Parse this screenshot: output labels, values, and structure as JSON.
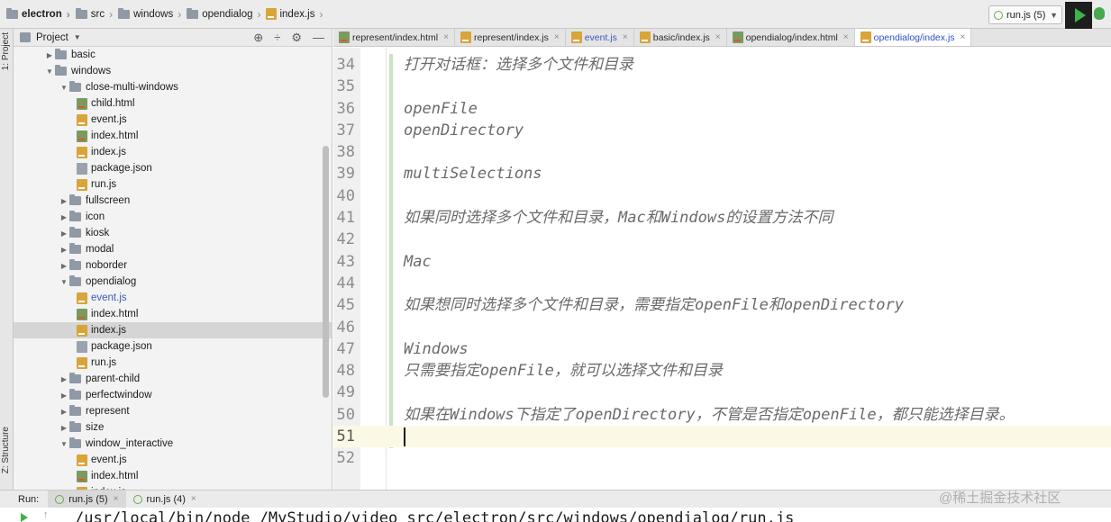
{
  "breadcrumb": {
    "items": [
      {
        "label": "electron",
        "icon": "folder-icon"
      },
      {
        "label": "src",
        "icon": "folder-icon"
      },
      {
        "label": "windows",
        "icon": "folder-icon"
      },
      {
        "label": "opendialog",
        "icon": "folder-icon"
      },
      {
        "label": "index.js",
        "icon": "js-file-icon"
      }
    ]
  },
  "toolbar": {
    "run_config": "run.js (5)",
    "run_icon": "play-icon",
    "debug_icon": "bug-icon"
  },
  "left_strip": {
    "project_tab": "1: Project",
    "structure_tab": "Z: Structure"
  },
  "project_panel": {
    "title": "Project",
    "tools": [
      "target-icon",
      "collapse-icon",
      "gear-icon",
      "minimize-icon"
    ]
  },
  "tree": [
    {
      "label": "basic",
      "type": "folder",
      "depth": 2,
      "expanded": false
    },
    {
      "label": "windows",
      "type": "folder",
      "depth": 2,
      "expanded": true
    },
    {
      "label": "close-multi-windows",
      "type": "folder",
      "depth": 3,
      "expanded": true
    },
    {
      "label": "child.html",
      "type": "html",
      "depth": 4
    },
    {
      "label": "event.js",
      "type": "js",
      "depth": 4
    },
    {
      "label": "index.html",
      "type": "html",
      "depth": 4
    },
    {
      "label": "index.js",
      "type": "js",
      "depth": 4
    },
    {
      "label": "package.json",
      "type": "json",
      "depth": 4
    },
    {
      "label": "run.js",
      "type": "js",
      "depth": 4
    },
    {
      "label": "fullscreen",
      "type": "folder",
      "depth": 3,
      "expanded": false
    },
    {
      "label": "icon",
      "type": "folder",
      "depth": 3,
      "expanded": false
    },
    {
      "label": "kiosk",
      "type": "folder",
      "depth": 3,
      "expanded": false
    },
    {
      "label": "modal",
      "type": "folder",
      "depth": 3,
      "expanded": false
    },
    {
      "label": "noborder",
      "type": "folder",
      "depth": 3,
      "expanded": false
    },
    {
      "label": "opendialog",
      "type": "folder",
      "depth": 3,
      "expanded": true
    },
    {
      "label": "event.js",
      "type": "js",
      "depth": 4,
      "modified": true
    },
    {
      "label": "index.html",
      "type": "html",
      "depth": 4
    },
    {
      "label": "index.js",
      "type": "js",
      "depth": 4,
      "selected": true
    },
    {
      "label": "package.json",
      "type": "json",
      "depth": 4
    },
    {
      "label": "run.js",
      "type": "js",
      "depth": 4
    },
    {
      "label": "parent-child",
      "type": "folder",
      "depth": 3,
      "expanded": false
    },
    {
      "label": "perfectwindow",
      "type": "folder",
      "depth": 3,
      "expanded": false
    },
    {
      "label": "represent",
      "type": "folder",
      "depth": 3,
      "expanded": false
    },
    {
      "label": "size",
      "type": "folder",
      "depth": 3,
      "expanded": false
    },
    {
      "label": "window_interactive",
      "type": "folder",
      "depth": 3,
      "expanded": true
    },
    {
      "label": "event.js",
      "type": "js",
      "depth": 4
    },
    {
      "label": "index.html",
      "type": "html",
      "depth": 4
    },
    {
      "label": "index.js",
      "type": "js",
      "depth": 4
    }
  ],
  "editor_tabs": [
    {
      "label": "represent/index.html",
      "type": "html"
    },
    {
      "label": "represent/index.js",
      "type": "js"
    },
    {
      "label": "event.js",
      "type": "js",
      "modified": true
    },
    {
      "label": "basic/index.js",
      "type": "js"
    },
    {
      "label": "opendialog/index.html",
      "type": "html"
    },
    {
      "label": "opendialog/index.js",
      "type": "js",
      "active": true
    }
  ],
  "editor": {
    "lines": [
      {
        "n": "34",
        "text": "打开对话框：选择多个文件和目录"
      },
      {
        "n": "35",
        "text": ""
      },
      {
        "n": "36",
        "text": "openFile"
      },
      {
        "n": "37",
        "text": "openDirectory"
      },
      {
        "n": "38",
        "text": ""
      },
      {
        "n": "39",
        "text": "multiSelections"
      },
      {
        "n": "40",
        "text": ""
      },
      {
        "n": "41",
        "text": "如果同时选择多个文件和目录，Mac和Windows的设置方法不同"
      },
      {
        "n": "42",
        "text": ""
      },
      {
        "n": "43",
        "text": "Mac"
      },
      {
        "n": "44",
        "text": ""
      },
      {
        "n": "45",
        "text": "如果想同时选择多个文件和目录，需要指定openFile和openDirectory"
      },
      {
        "n": "46",
        "text": ""
      },
      {
        "n": "47",
        "text": "Windows"
      },
      {
        "n": "48",
        "text": "只需要指定openFile，就可以选择文件和目录"
      },
      {
        "n": "49",
        "text": ""
      },
      {
        "n": "50",
        "text": "如果在Windows下指定了openDirectory，不管是否指定openFile，都只能选择目录。"
      },
      {
        "n": "51",
        "text": "",
        "current": true
      },
      {
        "n": "52",
        "text": ""
      }
    ]
  },
  "run_panel": {
    "label": "Run:",
    "tabs": [
      {
        "label": "run.js (5)",
        "active": true
      },
      {
        "label": "run.js (4)",
        "active": false
      }
    ],
    "command": "/usr/local/bin/node /MyStudio/video_src/electron/src/windows/opendialog/run.js"
  },
  "watermark": "@稀土掘金技术社区"
}
